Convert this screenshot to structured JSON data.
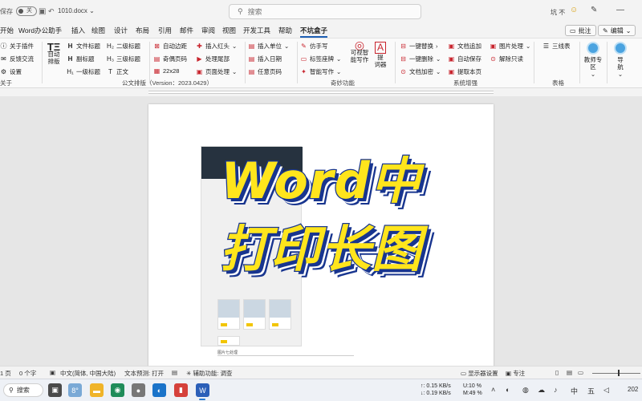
{
  "titlebar": {
    "autosave_label": "保存",
    "autosave_state": "关",
    "doc_name": "1010.docx",
    "search_placeholder": "搜索",
    "user_name": "坑 不"
  },
  "menu": {
    "tabs": [
      "开始",
      "Word办公助手",
      "插入",
      "绘图",
      "设计",
      "布局",
      "引用",
      "邮件",
      "审阅",
      "视图",
      "开发工具",
      "帮助",
      "不坑盒子"
    ],
    "active_tab": "不坑盒子",
    "comment_label": "批注",
    "edit_label": "编辑"
  },
  "ribbon": {
    "about": {
      "items": [
        "关于插件",
        "反馈交流",
        "设置"
      ],
      "group": "关于"
    },
    "official": {
      "auto_layout": "自动\n排版",
      "items": [
        "文件标题",
        "二级标题",
        "副标题",
        "三级标题",
        "一级标题",
        "正文"
      ],
      "items2": [
        "自动边距",
        "插入红头",
        "奇偶页码",
        "处理尾部",
        "22x28",
        "页面处理"
      ],
      "group": "公文排版（Version：2023.0429）"
    },
    "insert": {
      "items": [
        "插入单位",
        "插入日期",
        "任意页码"
      ]
    },
    "tricks": {
      "items": [
        "仿手写",
        "标签座牌",
        "智能写作"
      ],
      "big1": "可视智\n能写作",
      "big2": "提\n词器",
      "group": "奇妙功能"
    },
    "system": {
      "items": [
        "一键替换",
        "一键删除",
        "文档加密",
        "文档追加",
        "自动保存",
        "提取本页",
        "图片处理",
        "解除只读"
      ],
      "group": "系统增强"
    },
    "table": {
      "items": [
        "三线表"
      ],
      "group": "表格"
    },
    "teacher": {
      "label": "教师专\n区"
    },
    "nav": {
      "label": "导\n航"
    }
  },
  "document": {
    "headline_line1": "Word中",
    "headline_line2": "打印长图",
    "image_caption": "图片七处理"
  },
  "statusbar": {
    "page": "1 页",
    "words": "0 个字",
    "language": "中文(简体, 中国大陆)",
    "predict": "文本预测: 打开",
    "accessibility": "辅助功能: 调查",
    "display": "显示器设置",
    "focus": "专注"
  },
  "taskbar": {
    "search_label": "搜索",
    "weather": "8°",
    "net_up": "↑: 0.15 KB/s",
    "net_down": "↓: 0.19 KB/s",
    "cpu": "U:10 %",
    "mem": "M:49 %",
    "ime_lang": "中",
    "ime_day": "五",
    "time_partial": "202"
  },
  "colors": {
    "accent": "#1e5fb4",
    "headline_fill": "#ffe51c",
    "headline_stroke": "#18358f",
    "ribbon_red": "#c8242d"
  }
}
